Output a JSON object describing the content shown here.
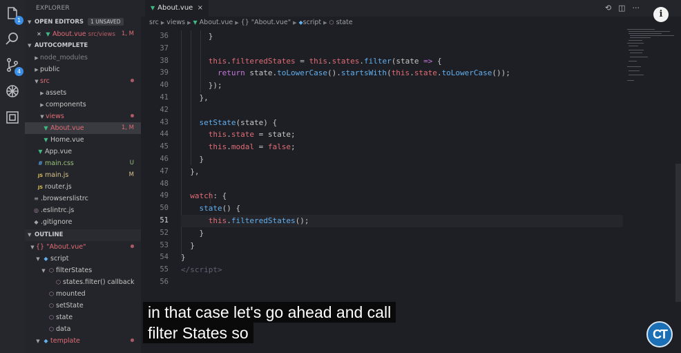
{
  "activity_bar": {
    "icons": [
      {
        "name": "files-icon",
        "badge": "1"
      },
      {
        "name": "search-icon",
        "badge": ""
      },
      {
        "name": "source-control-icon",
        "badge": "4"
      },
      {
        "name": "debug-icon",
        "badge": ""
      },
      {
        "name": "extensions-icon",
        "badge": ""
      }
    ]
  },
  "sidebar": {
    "title": "EXPLORER",
    "open_editors": {
      "label": "OPEN EDITORS",
      "unsaved_badge": "1 UNSAVED",
      "file": "About.vue",
      "path": "src/views",
      "status": "1, M"
    },
    "project": {
      "label": "AUTOCOMPLETE",
      "items": [
        {
          "label": "node_modules",
          "type": "folder"
        },
        {
          "label": "public",
          "type": "folder"
        },
        {
          "label": "src",
          "type": "folder-open"
        },
        {
          "label": "assets",
          "type": "folder"
        },
        {
          "label": "components",
          "type": "folder"
        },
        {
          "label": "views",
          "type": "folder-open"
        },
        {
          "label": "About.vue",
          "type": "vue",
          "status": "1, M"
        },
        {
          "label": "Home.vue",
          "type": "vue",
          "status": ""
        },
        {
          "label": "App.vue",
          "type": "vue",
          "status": ""
        },
        {
          "label": "main.css",
          "type": "css",
          "status": "U"
        },
        {
          "label": "main.js",
          "type": "js",
          "status": "M"
        },
        {
          "label": "router.js",
          "type": "js",
          "status": ""
        },
        {
          "label": ".browserslistrc",
          "type": "config",
          "status": ""
        },
        {
          "label": ".eslintrc.js",
          "type": "eslint",
          "status": ""
        },
        {
          "label": ".gitignore",
          "type": "git",
          "status": ""
        }
      ]
    },
    "outline": {
      "label": "OUTLINE",
      "items": [
        {
          "label": "{} \"About.vue\""
        },
        {
          "label": "script"
        },
        {
          "label": "filterStates"
        },
        {
          "label": "states.filter() callback"
        },
        {
          "label": "mounted"
        },
        {
          "label": "setState"
        },
        {
          "label": "state"
        },
        {
          "label": "data"
        },
        {
          "label": "template"
        }
      ]
    }
  },
  "editor": {
    "tab": {
      "label": "About.vue",
      "close": "×"
    },
    "tab_actions": [
      "⟲",
      "◫",
      "···"
    ],
    "breadcrumb": [
      "src",
      "views",
      "About.vue",
      "{} \"About.vue\"",
      "script",
      "state"
    ],
    "line_numbers": [
      "36",
      "37",
      "38",
      "39",
      "40",
      "41",
      "42",
      "43",
      "44",
      "45",
      "46",
      "47",
      "48",
      "49",
      "50",
      "51",
      "52",
      "53",
      "54",
      "55",
      "56"
    ],
    "active_line": "51"
  },
  "caption": {
    "line1": "in that case let's go ahead and call",
    "line2": "filter States so"
  },
  "logo": {
    "text": "CT"
  },
  "info_button": {
    "label": "i"
  }
}
